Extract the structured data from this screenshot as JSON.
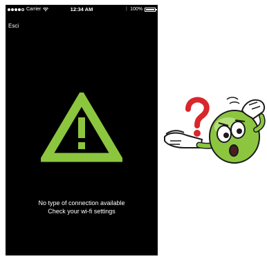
{
  "status_bar": {
    "carrier": "Carrier",
    "time": "12:34 AM",
    "battery": "100%",
    "signal_icon": "signal-icon",
    "wifi_icon": "wifi-icon",
    "bluetooth_icon": "bluetooth-icon",
    "battery_icon": "battery-icon"
  },
  "nav": {
    "exit_label": "Esci"
  },
  "alert": {
    "icon": "warning-triangle-icon",
    "icon_color": "#8cc63f",
    "line1": "No type of connection available",
    "line2": "Check your wi-fi settings"
  },
  "illustration": {
    "name": "confused-mascot",
    "question_mark_color": "#d9262c",
    "body_color": "#8cc63f"
  }
}
